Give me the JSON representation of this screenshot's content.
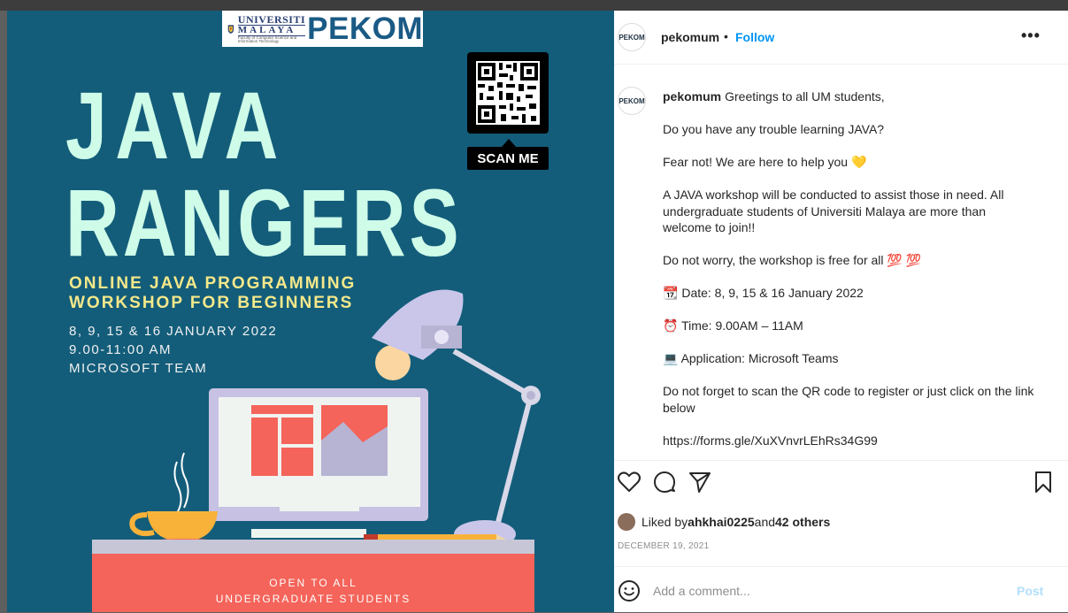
{
  "poster": {
    "logo_university_line1": "UNIVERSITI",
    "logo_university_line2": "MALAYA",
    "logo_faculty": "Faculty of Computer Science and Information Technology",
    "logo_pekom": "PEKOM",
    "scan_me": "SCAN ME",
    "title_line1": "JAVA",
    "title_line2": "RANGERS",
    "subtitle_line1": "ONLINE JAVA PROGRAMMING",
    "subtitle_line2": "WORKSHOP FOR BEGINNERS",
    "detail_dates": "8, 9, 15 & 16 JANUARY 2022",
    "detail_time": "9.00-11:00 AM",
    "detail_platform": "MICROSOFT TEAM",
    "banner_line1": "OPEN TO ALL",
    "banner_line2": "UNDERGRADUATE STUDENTS"
  },
  "header": {
    "avatar_text": "PEKOM",
    "username": "pekomum",
    "separator": "•",
    "follow_label": "Follow",
    "more_label": "•••"
  },
  "caption": {
    "avatar_text": "PEKOM",
    "username": "pekomum",
    "greeting": "Greetings to all UM students,",
    "line_question": "Do you have any trouble learning JAVA?",
    "line_fear": "Fear not! We are here to help you 💛",
    "line_workshop": "A JAVA workshop will be conducted to assist those in need. All undergraduate students of Universiti Malaya are more than welcome to join!!",
    "line_free": "Do not worry, the workshop is free for all 💯 💯",
    "line_date": "Date: 8, 9, 15 & 16 January 2022",
    "line_time": "Time: 9.00AM – 11AM",
    "line_app": "Application: Microsoft Teams",
    "line_register": "Do not forget to scan the QR code to register or just click on the link below",
    "line_link": "https://forms.gle/XuXVnvrLEhRs34G99",
    "emoji_date": "📆",
    "emoji_time": "⏰",
    "emoji_app": "💻"
  },
  "likes": {
    "prefix": "Liked by ",
    "user": "ahkhai0225",
    "middle": " and ",
    "others": "42 others"
  },
  "post_date": "DECEMBER 19, 2021",
  "comment": {
    "placeholder": "Add a comment...",
    "post_label": "Post"
  },
  "colors": {
    "poster_bg": "#135d7a",
    "title_mint": "#cffbe9",
    "subtitle_yellow": "#f5e88a",
    "accent_coral": "#f4645a",
    "link_blue": "#0095f6"
  }
}
